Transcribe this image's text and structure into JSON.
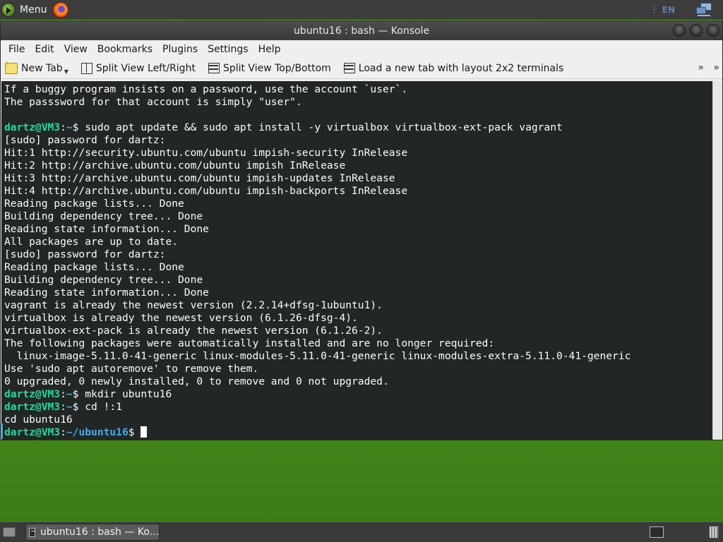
{
  "top_panel": {
    "menu_label": "Menu",
    "lang": "EN"
  },
  "window": {
    "title": "ubuntu16 : bash — Konsole",
    "menu": [
      "File",
      "Edit",
      "View",
      "Bookmarks",
      "Plugins",
      "Settings",
      "Help"
    ],
    "toolbar": {
      "new_tab": "New Tab",
      "split_lr": "Split View Left/Right",
      "split_tb": "Split View Top/Bottom",
      "layout_2x2": "Load a new tab with layout 2x2 terminals",
      "overflow": "»"
    }
  },
  "terminal": {
    "lines": [
      {
        "text": "If a buggy program insists on a password, use the account `user`."
      },
      {
        "text": "The passsword for that account is simply \"user\"."
      },
      {
        "text": ""
      },
      {
        "user": "dartz@VM3",
        "path": "~",
        "cmd": "sudo apt update && sudo apt install -y virtualbox virtualbox-ext-pack vagrant"
      },
      {
        "text": "[sudo] password for dartz:"
      },
      {
        "text": "Hit:1 http://security.ubuntu.com/ubuntu impish-security InRelease"
      },
      {
        "text": "Hit:2 http://archive.ubuntu.com/ubuntu impish InRelease"
      },
      {
        "text": "Hit:3 http://archive.ubuntu.com/ubuntu impish-updates InRelease"
      },
      {
        "text": "Hit:4 http://archive.ubuntu.com/ubuntu impish-backports InRelease"
      },
      {
        "text": "Reading package lists... Done"
      },
      {
        "text": "Building dependency tree... Done"
      },
      {
        "text": "Reading state information... Done"
      },
      {
        "text": "All packages are up to date."
      },
      {
        "text": "[sudo] password for dartz:"
      },
      {
        "text": "Reading package lists... Done"
      },
      {
        "text": "Building dependency tree... Done"
      },
      {
        "text": "Reading state information... Done"
      },
      {
        "text": "vagrant is already the newest version (2.2.14+dfsg-1ubuntu1)."
      },
      {
        "text": "virtualbox is already the newest version (6.1.26-dfsg-4)."
      },
      {
        "text": "virtualbox-ext-pack is already the newest version (6.1.26-2)."
      },
      {
        "text": "The following packages were automatically installed and are no longer required:"
      },
      {
        "text": "  linux-image-5.11.0-41-generic linux-modules-5.11.0-41-generic linux-modules-extra-5.11.0-41-generic"
      },
      {
        "text": "Use 'sudo apt autoremove' to remove them."
      },
      {
        "text": "0 upgraded, 0 newly installed, 0 to remove and 0 not upgraded."
      },
      {
        "user": "dartz@VM3",
        "path": "~",
        "cmd": "mkdir ubuntu16"
      },
      {
        "user": "dartz@VM3",
        "path": "~",
        "cmd": "cd !:1"
      },
      {
        "text": "cd ubuntu16"
      },
      {
        "user": "dartz@VM3",
        "path": "~/ubuntu16",
        "cmd": "",
        "cursor": true
      }
    ]
  },
  "taskbar": {
    "task_label": "ubuntu16 : bash — Ko..."
  },
  "colors": {
    "terminal_bg": "#232627",
    "prompt_user": "#1cdc9a",
    "prompt_path": "#3daee9"
  }
}
